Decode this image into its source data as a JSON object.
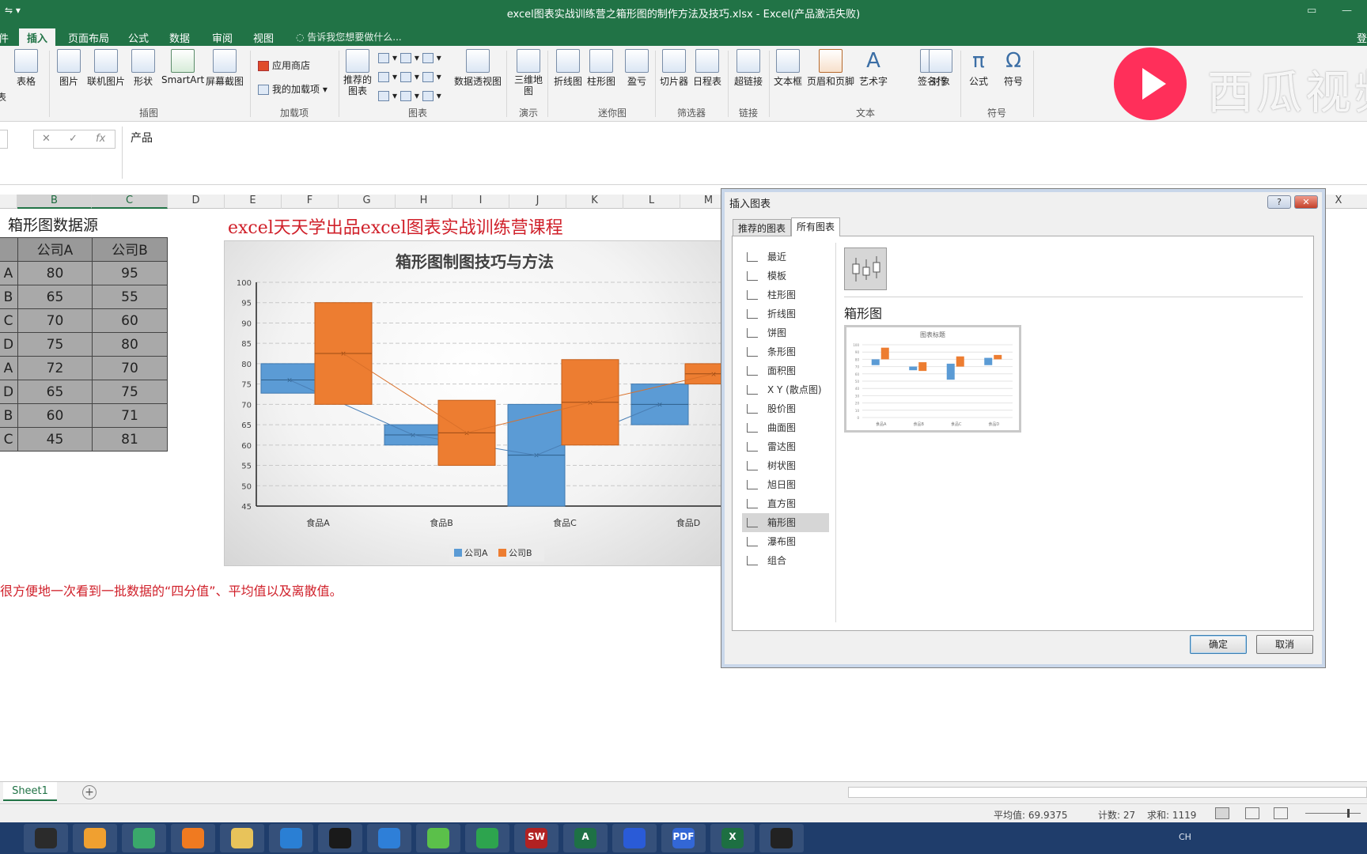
{
  "window": {
    "title": "excel图表实战训练营之箱形图的制作方法及技巧.xlsx - Excel(产品激活失败)",
    "quick_access": "⇋ ▾"
  },
  "tabs": [
    {
      "label": "件"
    },
    {
      "label": "插入",
      "active": true
    },
    {
      "label": "页面布局"
    },
    {
      "label": "公式"
    },
    {
      "label": "数据"
    },
    {
      "label": "审阅"
    },
    {
      "label": "视图"
    }
  ],
  "tell_me": "告诉我您想要做什么...",
  "sign_in": "登",
  "ribbon": {
    "buttons": {
      "table_frag": "表",
      "table": "表格",
      "picture": "图片",
      "online_picture": "联机图片",
      "shapes": "形状",
      "smartart": "SmartArt",
      "screenshot": "屏幕截图",
      "store": "应用商店",
      "my_addins": "我的加载项",
      "recommended_charts": "推荐的\n图表",
      "pivotchart": "数据透视图",
      "map_3d": "三维地\n图",
      "line_spark": "折线图",
      "column_spark": "柱形图",
      "winloss": "盈亏",
      "slicer": "切片器",
      "timeline": "日程表",
      "hyperlink": "超链接",
      "textbox": "文本框",
      "header_footer": "页眉和页脚",
      "wordart": "艺术字",
      "signature": "签名行",
      "object": "对象",
      "equation": "公式",
      "symbol": "符号"
    },
    "groups": {
      "illustrations": "插图",
      "addins": "加载项",
      "charts": "图表",
      "tours": "演示",
      "sparklines": "迷你图",
      "filters": "筛选器",
      "links": "链接",
      "text": "文本",
      "symbols": "符号"
    }
  },
  "watermark": "西瓜视频",
  "formula_bar": {
    "value": "产品",
    "cancel": "✕",
    "enter": "✓",
    "fx": "fx"
  },
  "columns": [
    "B",
    "C",
    "D",
    "E",
    "F",
    "G",
    "H",
    "I",
    "J",
    "K",
    "L",
    "M",
    "X"
  ],
  "table": {
    "title": "箱形图数据源",
    "headers": [
      "公司A",
      "公司B"
    ],
    "row_labels": [
      "A",
      "B",
      "C",
      "D",
      "A",
      "D",
      "B",
      "C"
    ],
    "rows": [
      [
        "80",
        "95"
      ],
      [
        "65",
        "55"
      ],
      [
        "70",
        "60"
      ],
      [
        "75",
        "80"
      ],
      [
        "72",
        "70"
      ],
      [
        "65",
        "75"
      ],
      [
        "60",
        "71"
      ],
      [
        "45",
        "81"
      ]
    ]
  },
  "banner": "excel天天学出品excel图表实战训练营课程",
  "note": "很方便地一次看到一批数据的“四分值”、平均值以及离散值。",
  "chart_data": {
    "type": "box",
    "title": "箱形图制图技巧与方法",
    "categories": [
      "食品A",
      "食品B",
      "食品C",
      "食品D"
    ],
    "ylim": [
      45,
      100
    ],
    "yticks": [
      45,
      50,
      55,
      60,
      65,
      70,
      75,
      80,
      85,
      90,
      95,
      100
    ],
    "grid": true,
    "legend_position": "bottom",
    "series": [
      {
        "name": "公司A",
        "color": "#5b9bd5",
        "boxes": [
          {
            "q1": 72.75,
            "median": 76,
            "q3": 80,
            "mean": 76
          },
          {
            "q1": 60,
            "median": 62.5,
            "q3": 65,
            "mean": 62.5
          },
          {
            "q1": 45,
            "median": 57.5,
            "q3": 70,
            "mean": 57.5
          },
          {
            "q1": 65,
            "median": 70,
            "q3": 75,
            "mean": 70
          }
        ]
      },
      {
        "name": "公司B",
        "color": "#ed7d31",
        "boxes": [
          {
            "q1": 70,
            "median": 82.5,
            "q3": 95,
            "mean": 82.5
          },
          {
            "q1": 55,
            "median": 63,
            "q3": 71,
            "mean": 63
          },
          {
            "q1": 60,
            "median": 70.5,
            "q3": 81,
            "mean": 70.5
          },
          {
            "q1": 75,
            "median": 77.5,
            "q3": 80,
            "mean": 77.5
          }
        ]
      }
    ]
  },
  "dialog": {
    "title": "插入图表",
    "help": "?",
    "close": "✕",
    "tabs": [
      {
        "label": "推荐的图表"
      },
      {
        "label": "所有图表",
        "active": true
      }
    ],
    "chart_types": [
      {
        "label": "最近"
      },
      {
        "label": "模板"
      },
      {
        "label": "柱形图"
      },
      {
        "label": "折线图"
      },
      {
        "label": "饼图"
      },
      {
        "label": "条形图"
      },
      {
        "label": "面积图"
      },
      {
        "label": "X Y (散点图)"
      },
      {
        "label": "股价图"
      },
      {
        "label": "曲面图"
      },
      {
        "label": "雷达图"
      },
      {
        "label": "树状图"
      },
      {
        "label": "旭日图"
      },
      {
        "label": "直方图"
      },
      {
        "label": "箱形图",
        "selected": true
      },
      {
        "label": "瀑布图"
      },
      {
        "label": "组合"
      }
    ],
    "selected_type_name": "箱形图",
    "preview_title": "图表标题",
    "ok": "确定",
    "cancel": "取消"
  },
  "sheet_tab": "Sheet1",
  "add_sheet": "+",
  "status": {
    "average": "平均值: 69.9375",
    "count": "计数: 27",
    "sum": "求和: 1119"
  },
  "taskbar": {
    "apps": [
      {
        "name": "camera-app"
      },
      {
        "name": "photos-app"
      },
      {
        "name": "atom-app"
      },
      {
        "name": "uc-browser-app"
      },
      {
        "name": "file-explorer-app"
      },
      {
        "name": "ie-browser-app"
      },
      {
        "name": "box-app"
      },
      {
        "name": "feather-app"
      },
      {
        "name": "refresh-app"
      },
      {
        "name": "green-app"
      },
      {
        "name": "solidworks-app"
      },
      {
        "name": "access-app"
      },
      {
        "name": "bluetooth-app"
      },
      {
        "name": "pdf-app"
      },
      {
        "name": "excel-app"
      },
      {
        "name": "recorder-app"
      }
    ],
    "labels": {
      "sw": "SW",
      "pdf": "PDF",
      "excel": "X",
      "access": "A"
    },
    "tray": "CH"
  }
}
